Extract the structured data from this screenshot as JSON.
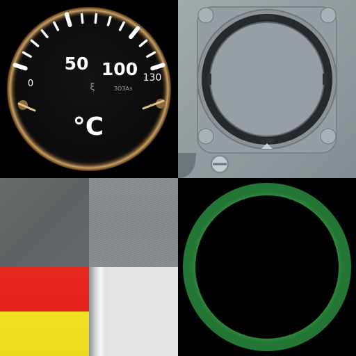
{
  "gauge": {
    "scale_labels": [
      "0",
      "50",
      "100",
      "130"
    ],
    "maker_mark": "ЗОЗАз",
    "unit": "°C",
    "colors": {
      "face": "#0b0b0c",
      "markings": "#ffffff",
      "rim": "#e6b56a"
    }
  },
  "bezel": {
    "colors": {
      "plate": "#8f979c",
      "ring": "#262a2d",
      "screw": "#c5cbd0"
    }
  },
  "swatches": {
    "colors": {
      "dark_grey": "#63676a",
      "brushed_grey": "#8a8e90",
      "red": "#e5251f",
      "yellow": "#efdd1f",
      "metal_white": "#e6e6e6"
    }
  },
  "ring": {
    "colors": {
      "ring": "#2d8a3e",
      "center": "#000000"
    }
  }
}
